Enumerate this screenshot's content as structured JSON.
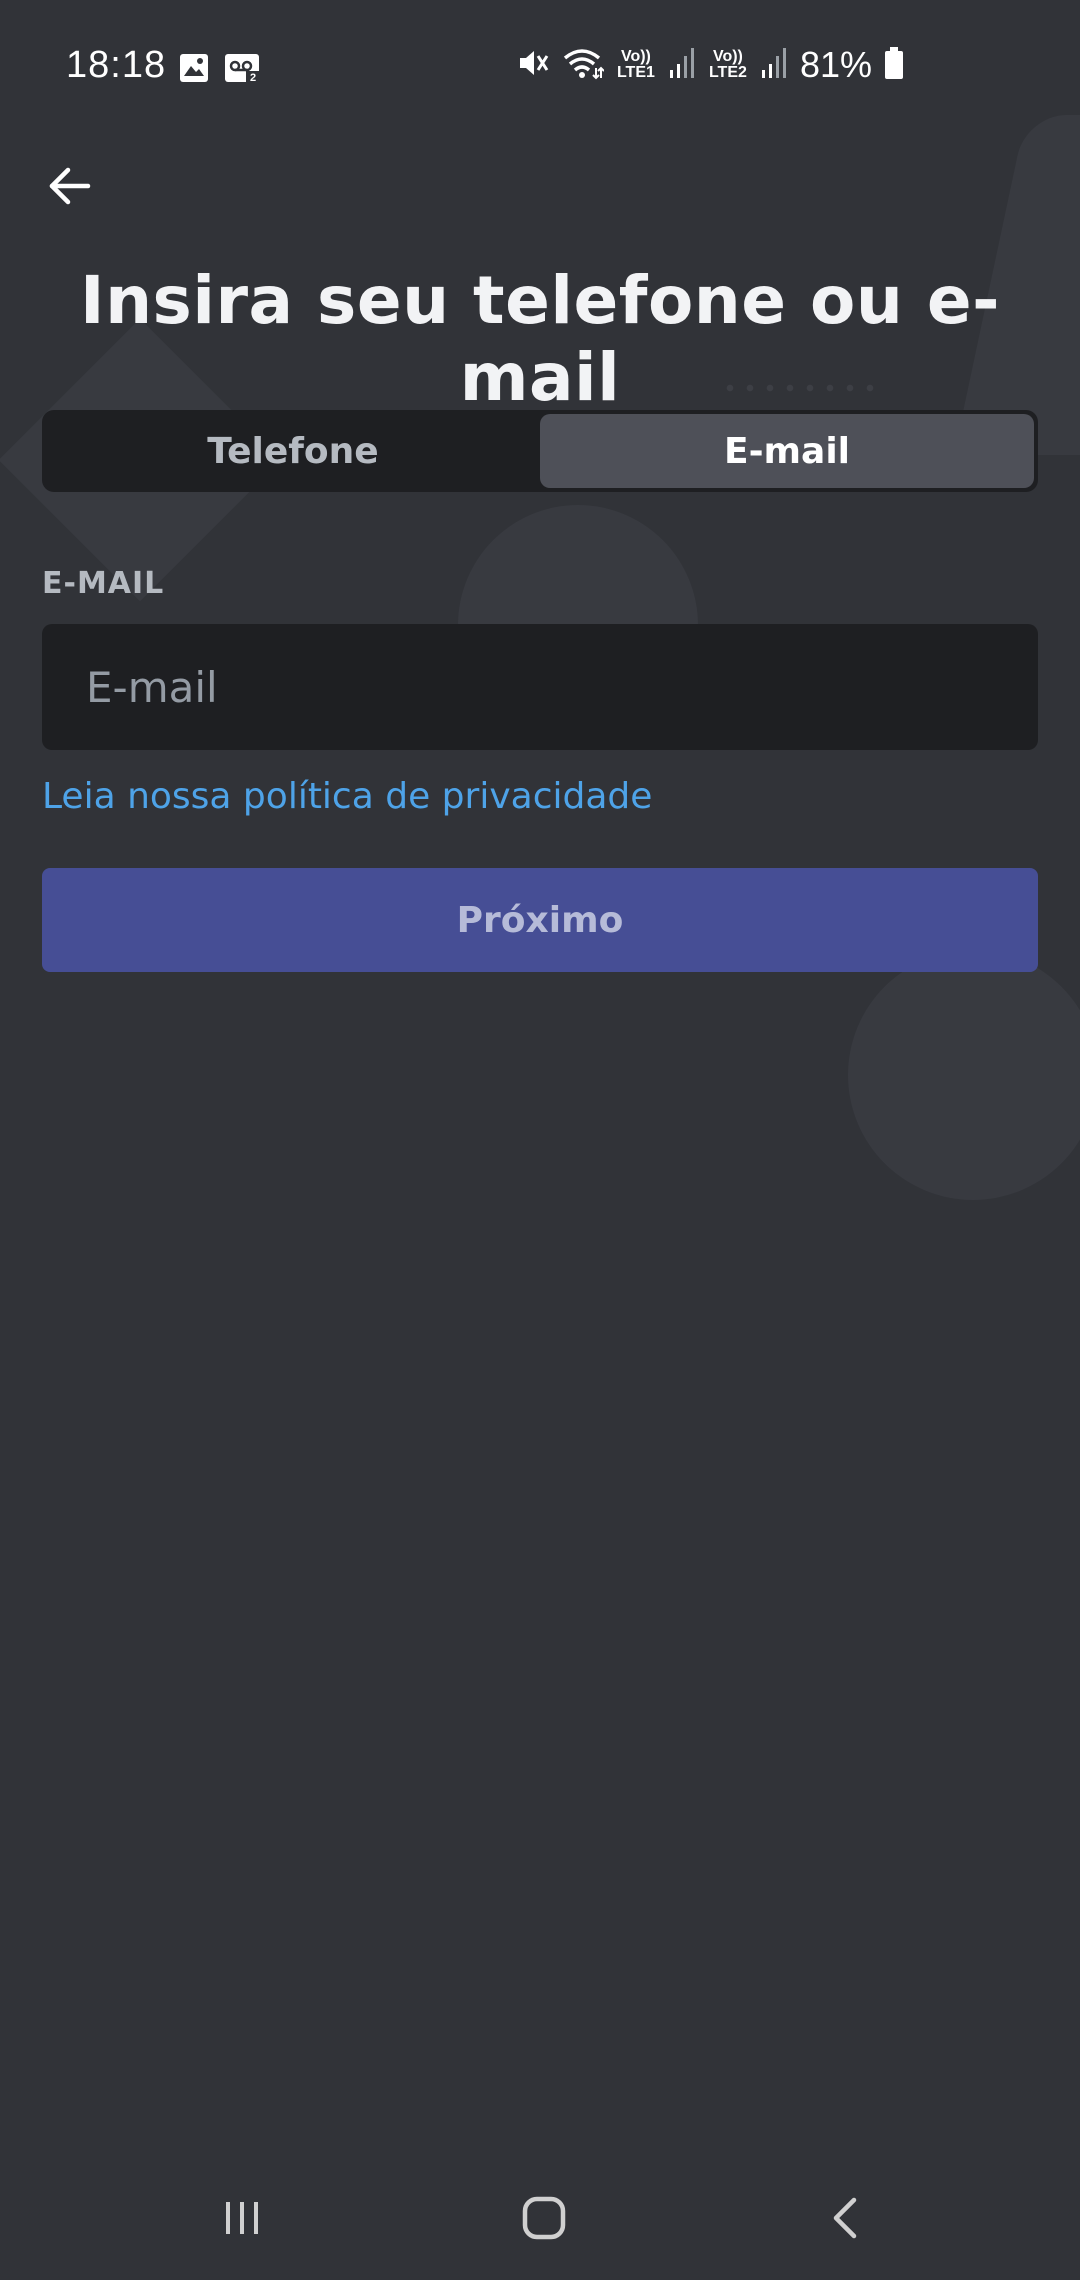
{
  "status_bar": {
    "time": "18:18",
    "battery_percent": "81%",
    "sim1_label_top": "Vo))",
    "sim1_label_bottom": "LTE1",
    "sim2_label_top": "Vo))",
    "sim2_label_bottom": "LTE2",
    "icons": [
      "gallery-icon",
      "voicemail-icon",
      "mute-icon",
      "wifi-icon",
      "signal-icon",
      "battery-icon"
    ]
  },
  "header": {
    "title": "Insira seu telefone ou e-mail"
  },
  "tabs": [
    {
      "label": "Telefone",
      "selected": false
    },
    {
      "label": "E-mail",
      "selected": true
    }
  ],
  "form": {
    "email_label": "E-MAIL",
    "email_value": "",
    "email_placeholder": "E-mail",
    "privacy_link": "Leia nossa política de privacidade",
    "next_label": "Próximo"
  },
  "colors": {
    "background": "#313338",
    "input_bg": "#1e1f22",
    "selected_tab_bg": "#4e5058",
    "link": "#4ea3e8",
    "primary_button": "#464e95"
  },
  "nav_bar": {
    "icons": [
      "recent-apps-icon",
      "home-icon",
      "back-nav-icon"
    ]
  }
}
